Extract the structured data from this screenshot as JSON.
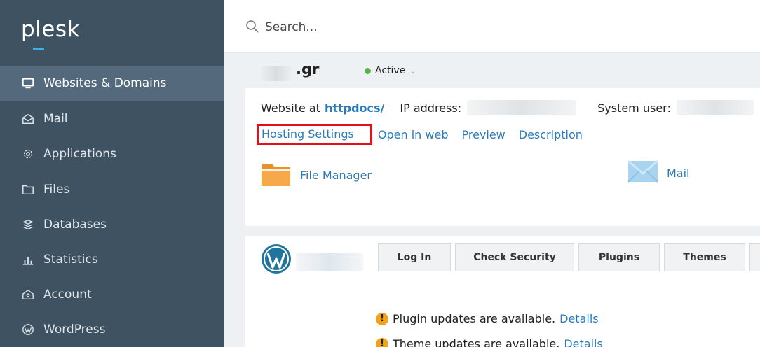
{
  "sidebar": {
    "logo": "plesk",
    "items": [
      {
        "label": "Websites & Domains",
        "icon": "monitor-icon",
        "active": true
      },
      {
        "label": "Mail",
        "icon": "envelope-icon"
      },
      {
        "label": "Applications",
        "icon": "gear-icon"
      },
      {
        "label": "Files",
        "icon": "folder-icon"
      },
      {
        "label": "Databases",
        "icon": "database-icon"
      },
      {
        "label": "Statistics",
        "icon": "bar-chart-icon"
      },
      {
        "label": "Account",
        "icon": "account-icon"
      },
      {
        "label": "WordPress",
        "icon": "wordpress-icon"
      }
    ]
  },
  "search": {
    "placeholder": "Search..."
  },
  "domain": {
    "name": ".gr",
    "status": "Active"
  },
  "info": {
    "website_at_label": "Website at",
    "docroot_link": "httpdocs/",
    "ip_label": "IP address:",
    "system_user_label": "System user:"
  },
  "links": {
    "hosting_settings": "Hosting Settings",
    "open_in_web": "Open in web",
    "preview": "Preview",
    "description": "Description"
  },
  "tools": {
    "file_manager": "File Manager",
    "mail": "Mail"
  },
  "wordpress": {
    "buttons": {
      "login": "Log In",
      "check_security": "Check Security",
      "plugins": "Plugins",
      "themes": "Themes"
    },
    "notices": [
      {
        "text": "Plugin updates are available.",
        "link": "Details"
      },
      {
        "text": "Theme updates are available.",
        "link": "Details"
      }
    ]
  },
  "colors": {
    "sidebar_bg": "#3f5262",
    "sidebar_active": "#546a7c",
    "link": "#2b7bb9",
    "highlight_box": "#e30f19",
    "status_active": "#5ab348",
    "warning": "#f0a31c"
  }
}
